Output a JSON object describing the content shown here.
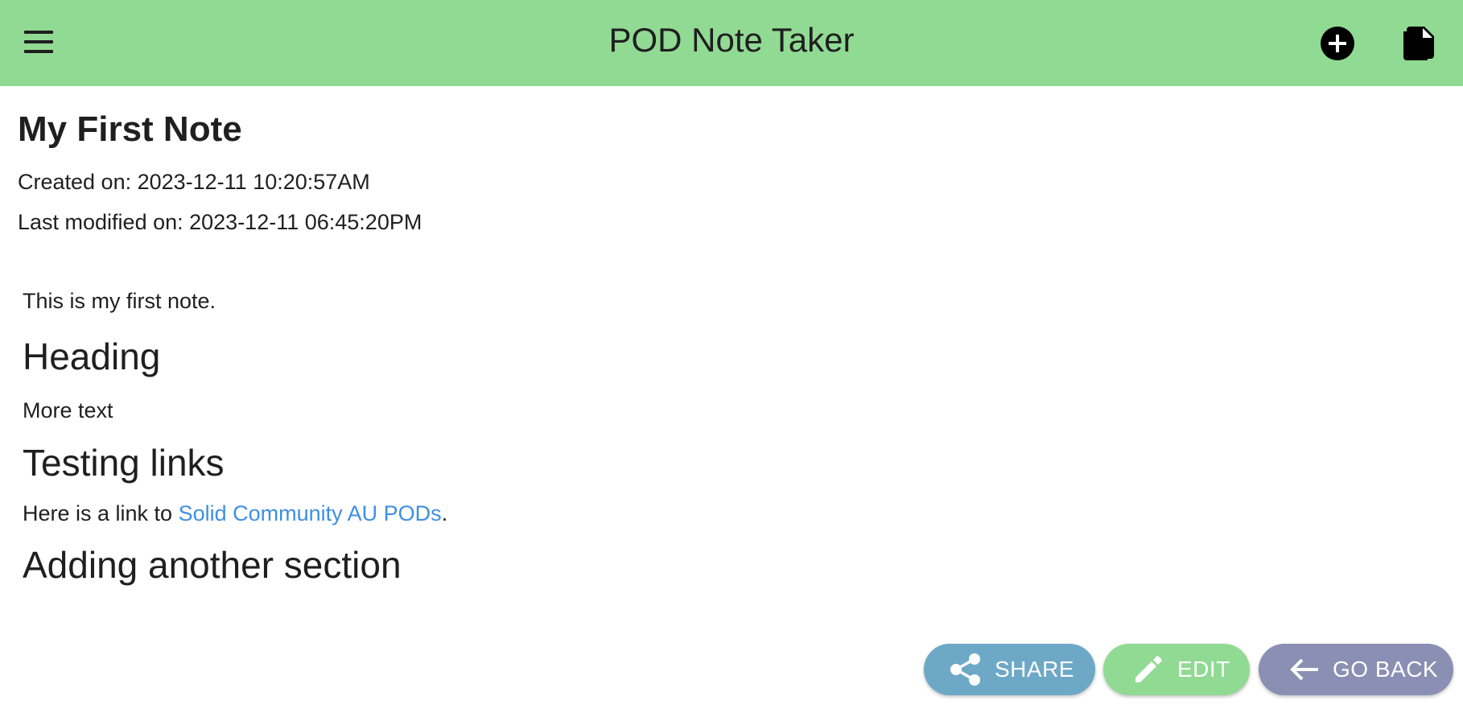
{
  "app_bar": {
    "title": "POD Note Taker",
    "background_color": "#91da93",
    "left_icon": "menu-icon",
    "right_icons": [
      "add-circle-icon",
      "file-copy-icon"
    ]
  },
  "note": {
    "title": "My First Note",
    "created": "Created on: 2023-12-11 10:20:57AM",
    "modified": "Last modified on: 2023-12-11 06:45:20PM",
    "paragraph_1": "This is my first note.",
    "heading_1": "Heading",
    "paragraph_2": "More text",
    "heading_2": "Testing links",
    "link_prefix": "Here is a link to ",
    "link_text": "Solid Community AU PODs",
    "link_suffix": ".",
    "heading_3": "Adding another section"
  },
  "actions": {
    "share": {
      "label": "SHARE",
      "icon": "share-icon",
      "color": "#6ea8c7"
    },
    "edit": {
      "label": "EDIT",
      "icon": "pencil-icon",
      "color": "#91da93"
    },
    "go_back": {
      "label": "GO BACK",
      "icon": "arrow-left-icon",
      "color": "#8a8fb3"
    }
  },
  "colors": {
    "link": "#3e8fe4"
  }
}
